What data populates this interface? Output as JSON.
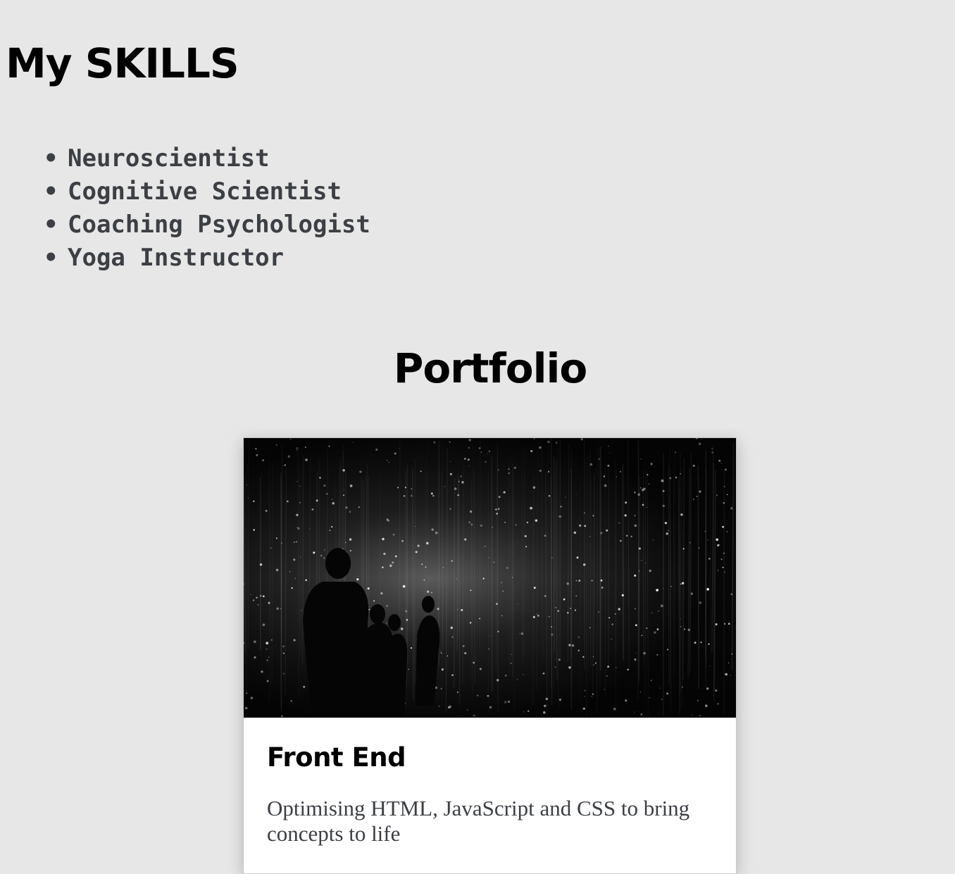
{
  "skills": {
    "title": "My SKILLS",
    "items": [
      "Neuroscientist",
      "Cognitive Scientist",
      "Coaching Psychologist",
      "Yoga Instructor"
    ]
  },
  "portfolio": {
    "title": "Portfolio",
    "cards": [
      {
        "title": "Front End",
        "description": "Optimising HTML, JavaScript and CSS to bring concepts to life"
      }
    ]
  },
  "colors": {
    "page_background": "#e7e7e7",
    "heading": "#000000",
    "body_text": "#3c3f44",
    "card_background": "#ffffff"
  }
}
